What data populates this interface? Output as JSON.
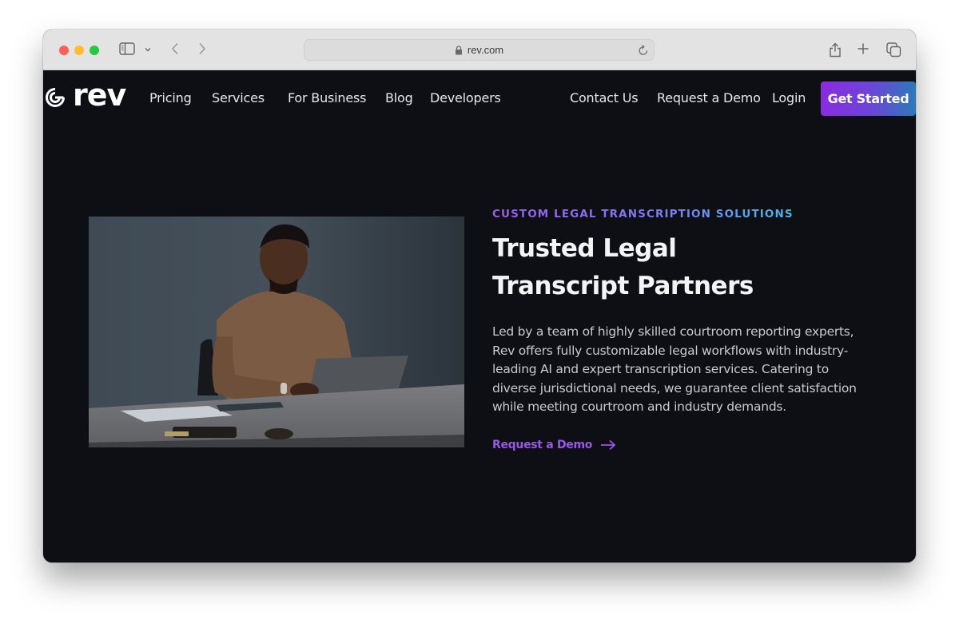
{
  "browser": {
    "url": "rev.com",
    "icons": {
      "sidebar": "sidebar-icon",
      "chevron": "chevron-down-icon",
      "back": "back-icon",
      "forward": "forward-icon",
      "lock": "lock-icon",
      "reload": "reload-icon",
      "share": "share-icon",
      "new_tab": "plus-icon",
      "tabs": "tabs-overview-icon"
    }
  },
  "nav": {
    "logo_text": "rev",
    "links_left": [
      "Pricing",
      "Services",
      "For Business",
      "Blog",
      "Developers"
    ],
    "links_right": [
      "Contact Us",
      "Request a Demo",
      "Login"
    ],
    "cta_label": "Get Started"
  },
  "hero": {
    "eyebrow": "CUSTOM LEGAL TRANSCRIPTION SOLUTIONS",
    "headline_line1": "Trusted Legal",
    "headline_line2": "Transcript Partners",
    "body": "Led by a team of highly skilled courtroom reporting experts, Rev offers fully customizable legal workflows with industry-leading AI and expert transcription services. Catering to diverse jurisdictional needs, we guarantee client satisfaction while meeting courtroom and industry demands.",
    "link_label": "Request a Demo",
    "image_alt": "Man in brown sweater typing on a laptop at a desk"
  },
  "colors": {
    "page_bg": "#0e0f14",
    "accent_purple": "#9a57ea",
    "cta_gradient_start": "#8a2be2",
    "cta_gradient_end": "#2b7ab8"
  }
}
